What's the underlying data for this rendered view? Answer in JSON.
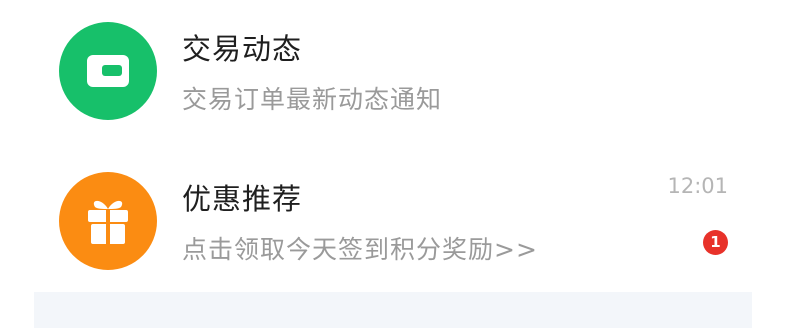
{
  "messages": [
    {
      "title": "交易动态",
      "subtitle": "交易订单最新动态通知",
      "icon": "wallet-icon",
      "icon_bg": "#17c06a"
    },
    {
      "title": "优惠推荐",
      "subtitle": "点击领取今天签到积分奖励>>",
      "time": "12:01",
      "badge": "1",
      "icon": "gift-icon",
      "icon_bg": "#fb8c12"
    }
  ],
  "colors": {
    "badge": "#e8322a",
    "title": "#1f1f1f",
    "subtitle": "#9a9a9a"
  }
}
